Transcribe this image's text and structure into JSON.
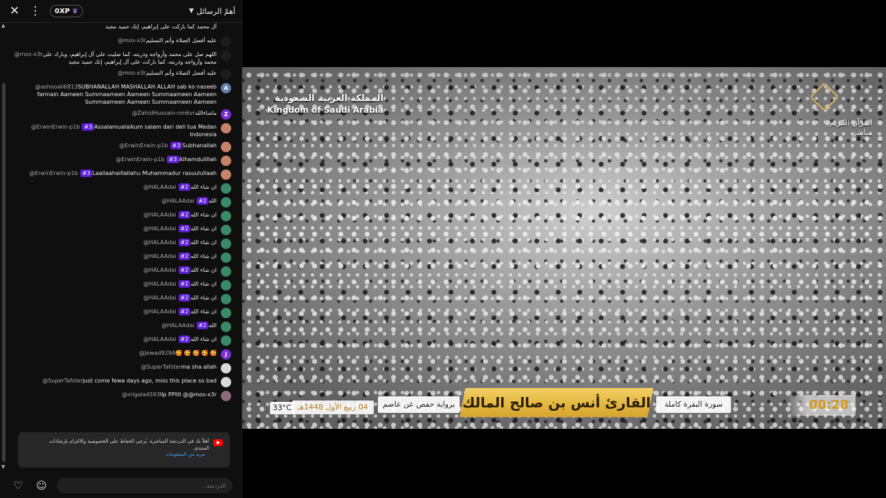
{
  "header": {
    "close_icon": "close-icon",
    "more_icon": "more-vert-icon",
    "xp_label": "0XP",
    "dropdown_label": "أهمّ الرسائل"
  },
  "messages": [
    {
      "author": "",
      "badge": "",
      "text": "آل محمد كما باركت على إبراهيم، إنك حميد مجيد",
      "rtl": true,
      "avatar": "",
      "avatar_color": "#0f0f0f"
    },
    {
      "author": "@mos-x3r",
      "badge": "",
      "text": "عليه أفضل الصلاة وأتم التسليم",
      "rtl": true,
      "avatar": "",
      "avatar_color": "#1c1c1c"
    },
    {
      "author": "@mos-x3r",
      "badge": "",
      "text": "اللهم صل على محمد وأزواجه وذريته، كما صليت على آل إبراهيم، وبارك على محمد وأزواجه وذريته، كما باركت على آل إبراهيم، إنك حميد مجيد",
      "rtl": true,
      "avatar": "",
      "avatar_color": "#1c1c1c"
    },
    {
      "author": "@mos-x3r",
      "badge": "",
      "text": "عليه أفضل الصلاة وأتم التسليم",
      "rtl": true,
      "avatar": "",
      "avatar_color": "#1c1c1c"
    },
    {
      "author": "@ashooali6813",
      "badge": "",
      "text": "SUBHANALLAH MASHALLAH ALLAH sab ko naseeb farmain Aameen Summaameen Aameen Summaameen Aameen Summaameen Aameen Summaameen Aameen",
      "rtl": false,
      "avatar": "A",
      "avatar_color": "#5e7ea8"
    },
    {
      "author": "@ZahidHussain-nm6vr",
      "badge": "",
      "text": "ماشاءالله",
      "rtl": true,
      "avatar": "Z",
      "avatar_color": "#7b2fd1"
    },
    {
      "author": "@ErwinErwin-p1b",
      "badge": "#3",
      "text": "Assalamualaikum salam dari deli tua Medan Indonesia",
      "rtl": false,
      "avatar": "",
      "avatar_color": "#c7836a"
    },
    {
      "author": "@ErwinErwin-p1b",
      "badge": "#3",
      "text": "Subhanallah",
      "rtl": false,
      "avatar": "",
      "avatar_color": "#c7836a"
    },
    {
      "author": "@ErwinErwin-p1b",
      "badge": "#3",
      "text": "Alhamdulillah",
      "rtl": false,
      "avatar": "",
      "avatar_color": "#c7836a"
    },
    {
      "author": "@ErwinErwin-p1b",
      "badge": "#3",
      "text": "Laailaahaillallahu Muhammadur rasuulullaah",
      "rtl": false,
      "avatar": "",
      "avatar_color": "#c7836a"
    },
    {
      "author": "@HALAAdai",
      "badge": "#2",
      "text": "ان شاء الله",
      "rtl": true,
      "avatar": "",
      "avatar_color": "#3a8a6a"
    },
    {
      "author": "@HALAAdai",
      "badge": "#2",
      "text": "الله",
      "rtl": true,
      "avatar": "",
      "avatar_color": "#3a8a6a"
    },
    {
      "author": "@HALAAdai",
      "badge": "#2",
      "text": "ان شاء الله",
      "rtl": true,
      "avatar": "",
      "avatar_color": "#3a8a6a"
    },
    {
      "author": "@HALAAdai",
      "badge": "#2",
      "text": "ان شاء الله",
      "rtl": true,
      "avatar": "",
      "avatar_color": "#3a8a6a"
    },
    {
      "author": "@HALAAdai",
      "badge": "#2",
      "text": "ان شاء الله",
      "rtl": true,
      "avatar": "",
      "avatar_color": "#3a8a6a"
    },
    {
      "author": "@HALAAdai",
      "badge": "#2",
      "text": "ان شاء الله",
      "rtl": true,
      "avatar": "",
      "avatar_color": "#3a8a6a"
    },
    {
      "author": "@HALAAdai",
      "badge": "#2",
      "text": "ان شاء الله",
      "rtl": true,
      "avatar": "",
      "avatar_color": "#3a8a6a"
    },
    {
      "author": "@HALAAdai",
      "badge": "#2",
      "text": "ان شاء الله",
      "rtl": true,
      "avatar": "",
      "avatar_color": "#3a8a6a"
    },
    {
      "author": "@HALAAdai",
      "badge": "#2",
      "text": "ان شاء الله",
      "rtl": true,
      "avatar": "",
      "avatar_color": "#3a8a6a"
    },
    {
      "author": "@HALAAdai",
      "badge": "#2",
      "text": "ان شاء الله",
      "rtl": true,
      "avatar": "",
      "avatar_color": "#3a8a6a"
    },
    {
      "author": "@HALAAdai",
      "badge": "#2",
      "text": "الله",
      "rtl": true,
      "avatar": "",
      "avatar_color": "#3a8a6a"
    },
    {
      "author": "@HALAAdai",
      "badge": "#2",
      "text": "ان شاء الله",
      "rtl": true,
      "avatar": "",
      "avatar_color": "#3a8a6a"
    },
    {
      "author": "@Jewad9294",
      "badge": "",
      "text": "🥰 🥰 🥰 🥰 🥰",
      "rtl": false,
      "avatar": "J",
      "avatar_color": "#7b2fd1"
    },
    {
      "author": "@SuperTafster",
      "badge": "",
      "text": "ma sha allah",
      "rtl": false,
      "avatar": "",
      "avatar_color": "#d9d9d9"
    },
    {
      "author": "@SuperTafster",
      "badge": "",
      "text": "just come fewa days ago, miss this place so bad",
      "rtl": false,
      "avatar": "",
      "avatar_color": "#d9d9d9"
    },
    {
      "author": "@srigala4593",
      "badge": "",
      "text": "llp PPllll @@mos-x3r",
      "rtl": false,
      "avatar": "",
      "avatar_color": "#8a6a7a"
    }
  ],
  "notice": {
    "text": "أهلاً بك في الدردشة المباشرة. يُرجى الحفاظ على الخصوصية والالتزام بإرشادات المنتدى.",
    "link": "مزيد من المعلومات",
    "icon": "youtube-icon"
  },
  "input": {
    "placeholder": "الدردشة...",
    "heart_icon": "heart-icon",
    "emoji_icon": "emoji-icon"
  },
  "video": {
    "logo_ar": "المملكة العربية السعودية",
    "logo_en": "Kingdom of Saudi Arabia",
    "channel_line1": "القرآن الكريم",
    "channel_line2": "مباشر",
    "temperature": "33°C",
    "date": "04 ربيع الأول 1448هـ",
    "riwaya": "برواية حفص عن عاصم",
    "reciter": "القارئ أنس بن صالح المالك",
    "surah": "سورة البقرة كاملة",
    "timer": "00:28"
  }
}
